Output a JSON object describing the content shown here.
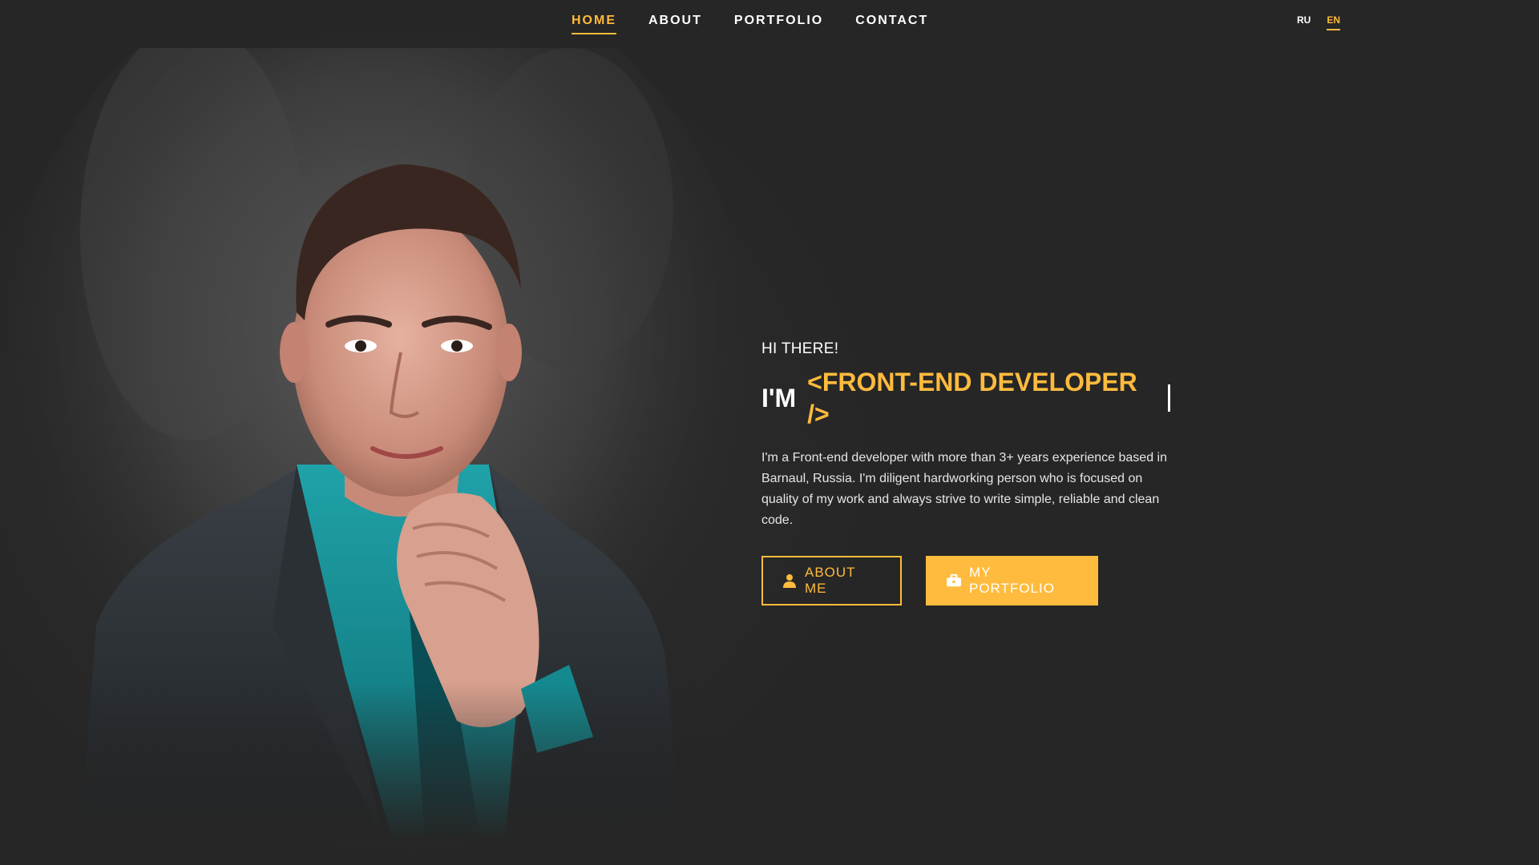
{
  "nav": {
    "items": [
      {
        "label": "HOME",
        "active": true
      },
      {
        "label": "ABOUT",
        "active": false
      },
      {
        "label": "PORTFOLIO",
        "active": false
      },
      {
        "label": "CONTACT",
        "active": false
      }
    ]
  },
  "languages": {
    "items": [
      {
        "label": "RU",
        "active": false
      },
      {
        "label": "EN",
        "active": true
      }
    ]
  },
  "hero": {
    "greeting": "HI THERE!",
    "headline_prefix": "I'M",
    "headline_role": "<FRONT-END DEVELOPER />",
    "bio": "I'm a Front-end developer with more than 3+ years experience based in Barnaul, Russia. I'm diligent hardworking person who is focused on quality of my work and always strive to write simple, reliable and clean code.",
    "buttons": {
      "about": {
        "label": "ABOUT ME",
        "icon": "user-icon"
      },
      "portfolio": {
        "label": "MY PORTFOLIO",
        "icon": "briefcase-icon"
      }
    }
  },
  "colors": {
    "accent": "#ffbb3d",
    "background": "#262626",
    "text": "#ffffff"
  }
}
